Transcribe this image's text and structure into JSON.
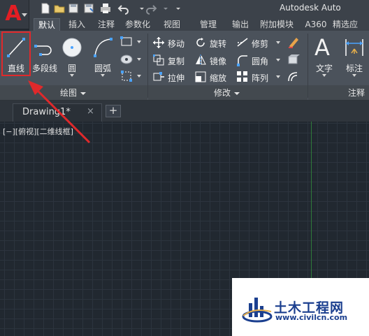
{
  "app": {
    "title": "Autodesk Auto",
    "logo_letter": "A"
  },
  "quick_access": {
    "icons": [
      "new-icon",
      "open-icon",
      "save-icon",
      "save-as-icon",
      "print-icon",
      "undo-icon",
      "redo-icon"
    ]
  },
  "ribbon_tabs": [
    {
      "label": "默认",
      "active": true
    },
    {
      "label": "插入",
      "active": false
    },
    {
      "label": "注释",
      "active": false
    },
    {
      "label": "参数化",
      "active": false
    },
    {
      "label": "视图",
      "active": false
    },
    {
      "label": "管理",
      "active": false
    },
    {
      "label": "输出",
      "active": false
    },
    {
      "label": "附加模块",
      "active": false
    },
    {
      "label": "A360",
      "active": false
    },
    {
      "label": "精选应",
      "active": false
    }
  ],
  "draw_panel": {
    "title": "绘图",
    "line": "直线",
    "polyline": "多段线",
    "circle": "圆",
    "arc": "圆弧"
  },
  "modify_panel": {
    "title": "修改",
    "move": "移动",
    "rotate": "旋转",
    "trim": "修剪",
    "copy": "复制",
    "mirror": "镜像",
    "fillet": "圆角",
    "stretch": "拉伸",
    "scale": "缩放",
    "array": "阵列"
  },
  "annotation_panel": {
    "title": "注释",
    "text": "文字",
    "dimension": "标注",
    "text_glyph": "A"
  },
  "document": {
    "tab_name": "Drawing1*",
    "close_glyph": "×",
    "add_glyph": "+"
  },
  "viewport": {
    "label": "[−][俯视][二维线框]"
  },
  "watermark": {
    "name": "土木工程网",
    "url": "www.civilcn.com"
  },
  "colors": {
    "accent_red": "#e0292b",
    "canvas_bg": "#212830",
    "ribbon_bg": "#4b525b",
    "watermark_blue": "#1b3f8f"
  }
}
